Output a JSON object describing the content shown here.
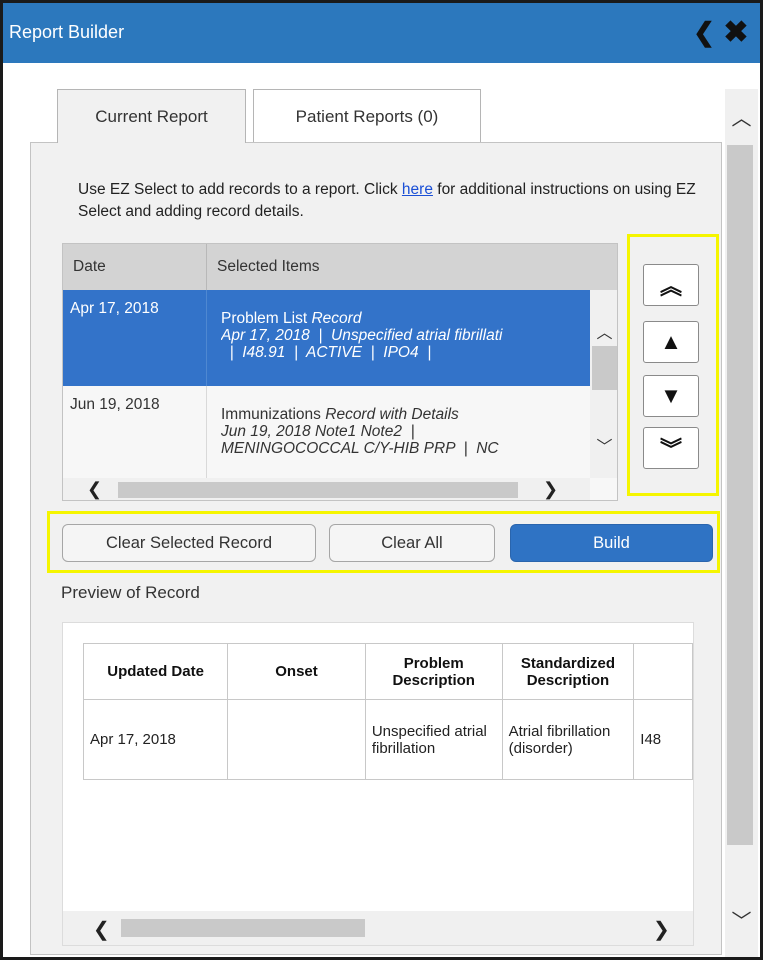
{
  "window": {
    "title": "Report Builder",
    "back_glyph": "❮",
    "close_glyph": "✖"
  },
  "tabs": [
    {
      "label": "Current Report",
      "active": true
    },
    {
      "label": "Patient Reports (0)",
      "active": false
    }
  ],
  "intro": {
    "text_before": "Use EZ Select to add records to a report. Click ",
    "link": "here",
    "text_after": " for additional instructions on using EZ Select and adding record details."
  },
  "selected_grid": {
    "headers": {
      "date": "Date",
      "items": "Selected Items"
    },
    "rows": [
      {
        "date": "Apr 17, 2018",
        "type": "Problem List",
        "kind": "Record",
        "line2": "Apr 17, 2018  |  Unspecified atrial fibrillati",
        "line3": "  |  I48.91  |  ACTIVE  |  IPO4  |",
        "selected": true
      },
      {
        "date": "Jun 19, 2018",
        "type": "Immunizations",
        "kind": "Record with Details",
        "line2": "Jun 19, 2018 Note1 Note2  |",
        "line3": "MENINGOCOCCAL C/Y-HIB PRP  |  NC",
        "selected": false
      }
    ]
  },
  "reorder_buttons": {
    "move_top": "︽",
    "move_up": "▲",
    "move_down": "▼",
    "move_bottom": "︾"
  },
  "actions": {
    "clear_selected": "Clear Selected Record",
    "clear_all": "Clear All",
    "build": "Build"
  },
  "preview": {
    "label": "Preview of Record",
    "headers": [
      "Updated Date",
      "Onset",
      "Problem Description",
      "Standardized Description",
      ""
    ],
    "row": [
      "Apr 17, 2018",
      "",
      "Unspecified atrial fibrillation",
      "Atrial fibrillation (disorder)",
      "I48"
    ]
  },
  "scroll_glyphs": {
    "up": "︿",
    "down": "﹀",
    "left": "❮",
    "right": "❯"
  },
  "colors": {
    "title_bar": "#2c78bd",
    "selected_row": "#3373c9",
    "build_button": "#2f73c4",
    "highlight": "#f5f500",
    "link": "#1a4fd6"
  }
}
